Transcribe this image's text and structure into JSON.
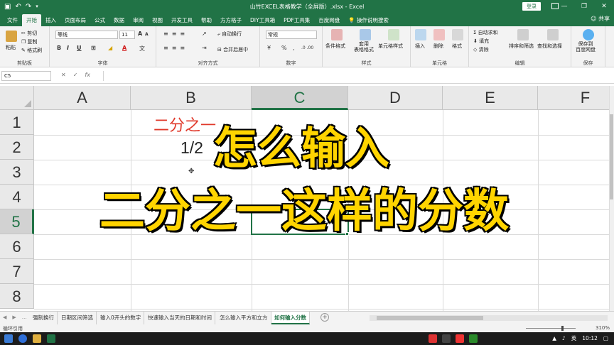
{
  "titlebar": {
    "title": "山竹EXCEL表格教学（全屏版）.xlsx  -  Excel",
    "login": "登录",
    "minimize": "—",
    "restore": "❐",
    "close": "✕",
    "undo": "↶",
    "redo": "↷",
    "save": "▣"
  },
  "tabs": [
    "文件",
    "开始",
    "插入",
    "页面布局",
    "公式",
    "数据",
    "审阅",
    "视图",
    "开发工具",
    "帮助",
    "方方格子",
    "DIY工具箱",
    "PDF工具集",
    "百度网盘"
  ],
  "active_tab": "开始",
  "search_tab": "操作说明搜索",
  "share": "共享",
  "ribbon": {
    "clipboard": {
      "label": "剪贴板",
      "paste": "粘贴",
      "cut": "剪切",
      "copy": "复制",
      "format_painter": "格式刷"
    },
    "font": {
      "label": "字体",
      "font_name": "等线",
      "font_size": "11",
      "bold": "B",
      "italic": "I",
      "underline": "U",
      "grow": "A",
      "shrink": "A",
      "font_color": "A",
      "fill_color": "◢"
    },
    "alignment": {
      "label": "对齐方式",
      "wrap": "自动换行",
      "merge": "合并后居中"
    },
    "number": {
      "label": "数字",
      "format": "常规",
      "percent": "%",
      "comma": ","
    },
    "styles": {
      "label": "样式",
      "conditional": "条件格式",
      "table": "套用\n表格格式",
      "cell_styles": "单元格样式"
    },
    "cells": {
      "label": "单元格",
      "insert": "插入",
      "delete": "删除",
      "format": "格式"
    },
    "editing": {
      "label": "编辑",
      "autosum": "自动求和",
      "fill": "填充",
      "clear": "清除",
      "sort": "排序和筛选",
      "find": "查找和选择"
    },
    "save": {
      "label": "保存",
      "save_baidu": "保存到\n百度网盘"
    }
  },
  "formula_bar": {
    "name_box": "C5",
    "cancel": "✕",
    "enter": "✓",
    "fx": "fx",
    "content": ""
  },
  "columns": [
    "A",
    "B",
    "C",
    "D",
    "E",
    "F"
  ],
  "selected_column": "C",
  "rows": [
    "1",
    "2",
    "3",
    "4",
    "5",
    "6",
    "7",
    "8"
  ],
  "selected_row": "5",
  "cells": {
    "B1": "二分之一",
    "B2": "1/2"
  },
  "colors": {
    "excel_green": "#217346",
    "b1_text": "#e0392b",
    "overlay_fill": "#ffd400"
  },
  "overlay": {
    "line1": "怎么输入",
    "line2": "二分之一这样的分数"
  },
  "sheets": [
    "强制换行",
    "日期区间筛选",
    "输入0开头的数字",
    "快速输入当天的日期和时间",
    "怎么输入平方和立方",
    "如何输入分数"
  ],
  "active_sheet": "如何输入分数",
  "add_sheet": "+",
  "status": {
    "mode": "循环引用",
    "zoom": "310%"
  },
  "taskbar": {
    "lang": "英",
    "time": "10:12"
  }
}
